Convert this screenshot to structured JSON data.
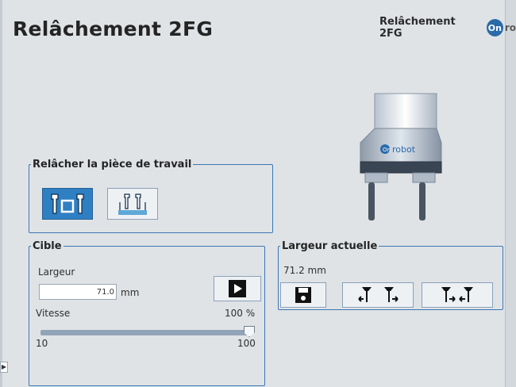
{
  "header": {
    "title": "Relâchement 2FG",
    "right_title": "Relâchement 2FG",
    "logo_text": "On",
    "logo_tail": "ro"
  },
  "gripper_image": {
    "brand_text": "robot",
    "badge_text": "On"
  },
  "release_group": {
    "legend": "Relâcher la pièce de travail",
    "modes": [
      {
        "name": "external-grip",
        "selected": true
      },
      {
        "name": "internal-grip",
        "selected": false
      }
    ]
  },
  "target_group": {
    "legend": "Cible",
    "width_label": "Largeur",
    "width_value": "71.0",
    "width_unit": "mm",
    "speed_label": "Vitesse",
    "speed_value": "100 %",
    "speed_percent": 100,
    "slider_min": "10",
    "slider_max": "100"
  },
  "current_group": {
    "legend": "Largeur actuelle",
    "value": "71.2 mm"
  },
  "colors": {
    "accent": "#2f7fc3",
    "border": "#3c76b2",
    "background": "#dfe3e6"
  },
  "icons": {
    "play": "play-icon",
    "save": "save-icon",
    "close_inward": "close-fingers-icon",
    "open_outward": "open-fingers-icon"
  }
}
